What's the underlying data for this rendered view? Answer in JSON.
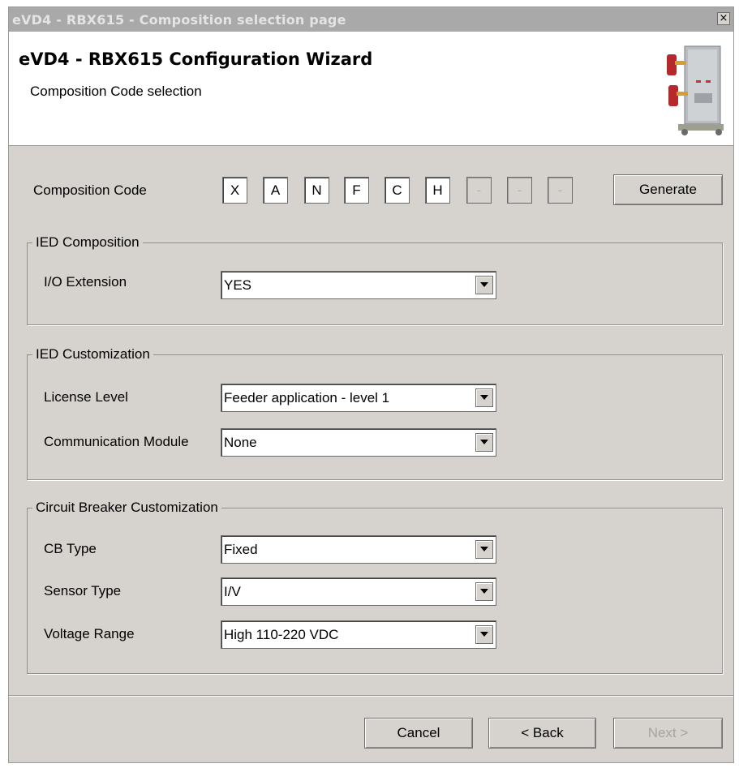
{
  "window": {
    "title": "eVD4 - RBX615 - Composition selection page",
    "close_label": "×"
  },
  "header": {
    "title": "eVD4 - RBX615 Configuration Wizard",
    "subtitle": "Composition Code selection"
  },
  "composition": {
    "label": "Composition Code",
    "code": [
      "X",
      "A",
      "N",
      "F",
      "C",
      "H",
      "-",
      "-",
      "-"
    ],
    "generate_label": "Generate"
  },
  "ied_composition": {
    "legend": "IED Composition",
    "fields": [
      {
        "label": "I/O Extension",
        "value": "YES"
      }
    ]
  },
  "ied_customization": {
    "legend": "IED Customization",
    "fields": [
      {
        "label": "License Level",
        "value": "Feeder application - level 1"
      },
      {
        "label": "Communication Module",
        "value": "None"
      }
    ]
  },
  "cb_customization": {
    "legend": "Circuit Breaker Customization",
    "fields": [
      {
        "label": "CB Type",
        "value": "Fixed"
      },
      {
        "label": "Sensor Type",
        "value": "I/V"
      },
      {
        "label": "Voltage Range",
        "value": "High 110-220 VDC"
      }
    ]
  },
  "footer": {
    "cancel_label": "Cancel",
    "back_label": "< Back",
    "next_label": "Next >"
  },
  "icons": {
    "dropdown": "chevron-down-icon",
    "product": "circuit-breaker-image"
  }
}
